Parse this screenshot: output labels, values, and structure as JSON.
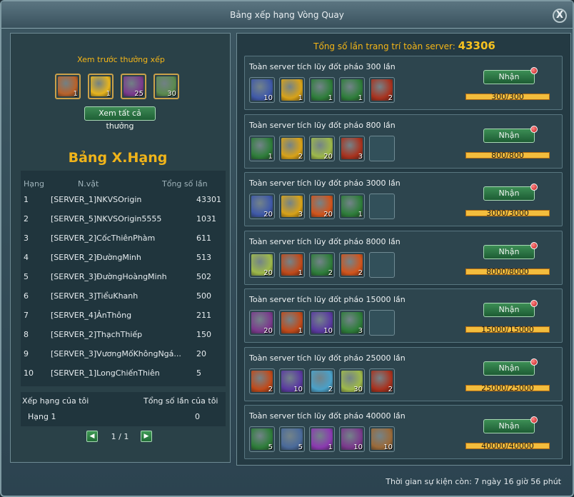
{
  "window": {
    "title": "Bảng xếp hạng Vòng Quay",
    "close_label": "X"
  },
  "preview": {
    "title": "Xem trước thưởng xếp",
    "items": [
      {
        "icon": "scroll-item-icon",
        "qty": "1",
        "color": "#b8622b"
      },
      {
        "icon": "gold-ingot-icon",
        "qty": "1",
        "color": "#e6b41e"
      },
      {
        "icon": "gift-box-icon",
        "qty": "25",
        "color": "#7a3a8c"
      },
      {
        "icon": "scroll-map-icon",
        "qty": "30",
        "color": "#5b8a4f"
      }
    ],
    "view_all_label": "Xem tất cả thưởng"
  },
  "ranking": {
    "title": "Bảng X.Hạng",
    "headers": {
      "rank": "Hạng",
      "name": "N.vật",
      "count": "Tổng số lần"
    },
    "rows": [
      {
        "rank": "1",
        "name": "[SERVER_1]NKVSOrigin",
        "count": "43301"
      },
      {
        "rank": "2",
        "name": "[SERVER_5]NKVSOrigin5555",
        "count": "1031"
      },
      {
        "rank": "3",
        "name": "[SERVER_2]CốcThiênPhàm",
        "count": "611"
      },
      {
        "rank": "4",
        "name": "[SERVER_2]ĐườngMinh",
        "count": "513"
      },
      {
        "rank": "5",
        "name": "[SERVER_3]ĐườngHoàngMinh",
        "count": "502"
      },
      {
        "rank": "6",
        "name": "[SERVER_3]TiểuKhanh",
        "count": "500"
      },
      {
        "rank": "7",
        "name": "[SERVER_4]ẢnThông",
        "count": "211"
      },
      {
        "rank": "8",
        "name": "[SERVER_2]ThạchThiếp",
        "count": "150"
      },
      {
        "rank": "9",
        "name": "[SERVER_3]VươngMốKhôngNgá...",
        "count": "20"
      },
      {
        "rank": "10",
        "name": "[SERVER_1]LongChiếnThiên",
        "count": "5"
      }
    ]
  },
  "my_rank": {
    "rank_label": "Xếp hạng của tôi",
    "count_label": "Tổng số lần của tôi",
    "rank_value": "Hạng 1",
    "count_value": "0"
  },
  "pager": {
    "text": "1 / 1",
    "prev": "◀",
    "next": "▶"
  },
  "total": {
    "label": "Tổng số lần trang trí toàn server:",
    "value": "43306"
  },
  "rewards": [
    {
      "label": "Toàn server tích lũy đốt pháo 300 lần",
      "button": "Nhận",
      "progress_text": "300/300",
      "progress": 1.0,
      "items": [
        {
          "icon": "purple-gem-icon",
          "qty": "10",
          "color": "#3f59a8"
        },
        {
          "icon": "gold-ingot-icon",
          "qty": "1",
          "color": "#d8a218"
        },
        {
          "icon": "green-book-icon",
          "qty": "1",
          "color": "#2e7d3a"
        },
        {
          "icon": "green-book-icon",
          "qty": "1",
          "color": "#2e7d3a"
        },
        {
          "icon": "red-armor-icon",
          "qty": "2",
          "color": "#a8321e"
        }
      ]
    },
    {
      "label": "Toàn server tích lũy đốt pháo 800 lần",
      "button": "Nhận",
      "progress_text": "800/800",
      "progress": 1.0,
      "items": [
        {
          "icon": "green-book-icon",
          "qty": "1",
          "color": "#2e7d3a"
        },
        {
          "icon": "gold-ingot-icon",
          "qty": "2",
          "color": "#d8a218"
        },
        {
          "icon": "mystery-box-icon",
          "qty": "20",
          "color": "#9db84a"
        },
        {
          "icon": "red-armor-icon",
          "qty": "3",
          "color": "#a8321e"
        }
      ]
    },
    {
      "label": "Toàn server tích lũy đốt pháo 3000 lần",
      "button": "Nhận",
      "progress_text": "3000/3000",
      "progress": 1.0,
      "items": [
        {
          "icon": "purple-gem-icon",
          "qty": "20",
          "color": "#3f59a8"
        },
        {
          "icon": "gold-ingot-icon",
          "qty": "3",
          "color": "#d8a218"
        },
        {
          "icon": "fire-burst-icon",
          "qty": "20",
          "color": "#d0541c"
        },
        {
          "icon": "green-book-icon",
          "qty": "1",
          "color": "#2e7d3a"
        }
      ]
    },
    {
      "label": "Toàn server tích lũy đốt pháo 8000 lần",
      "button": "Nhận",
      "progress_text": "8000/8000",
      "progress": 1.0,
      "items": [
        {
          "icon": "mystery-box-icon",
          "qty": "20",
          "color": "#9db84a"
        },
        {
          "icon": "red-gold-helmet-icon",
          "qty": "1",
          "color": "#c04a1a"
        },
        {
          "icon": "green-book-icon",
          "qty": "2",
          "color": "#2e7d3a"
        },
        {
          "icon": "fire-burst-icon",
          "qty": "2",
          "color": "#d0541c"
        }
      ]
    },
    {
      "label": "Toàn server tích lũy đốt pháo 15000 lần",
      "button": "Nhận",
      "progress_text": "15000/15000",
      "progress": 1.0,
      "items": [
        {
          "icon": "gift-box-icon",
          "qty": "20",
          "color": "#7a3a8c"
        },
        {
          "icon": "red-gold-helmet-icon",
          "qty": "1",
          "color": "#c04a1a"
        },
        {
          "icon": "pet-egg-icon",
          "qty": "10",
          "color": "#5a3aa0"
        },
        {
          "icon": "green-book-icon",
          "qty": "3",
          "color": "#2e7d3a"
        }
      ]
    },
    {
      "label": "Toàn server tích lũy đốt pháo 25000 lần",
      "button": "Nhận",
      "progress_text": "25000/25000",
      "progress": 1.0,
      "items": [
        {
          "icon": "red-gold-helmet-icon",
          "qty": "2",
          "color": "#c04a1a"
        },
        {
          "icon": "pet-egg-icon",
          "qty": "10",
          "color": "#5a3aa0"
        },
        {
          "icon": "mystery-box-icon",
          "qty": "2",
          "color": "#4aa0c8"
        },
        {
          "icon": "mystery-box-icon",
          "qty": "30",
          "color": "#9db84a"
        },
        {
          "icon": "red-armor-icon",
          "qty": "2",
          "color": "#a8321e"
        }
      ]
    },
    {
      "label": "Toàn server tích lũy đốt pháo 40000 lần",
      "button": "Nhận",
      "progress_text": "40000/40000",
      "progress": 1.0,
      "items": [
        {
          "icon": "green-book-icon",
          "qty": "5",
          "color": "#2e7d3a"
        },
        {
          "icon": "red-thread-icon",
          "qty": "5",
          "color": "#4a6a9a"
        },
        {
          "icon": "purple-bag-icon",
          "qty": "1",
          "color": "#8a3ab0"
        },
        {
          "icon": "gift-box-icon",
          "qty": "10",
          "color": "#7a3a8c"
        },
        {
          "icon": "gift-box-icon",
          "qty": "10",
          "color": "#9a6a3a"
        }
      ]
    }
  ],
  "footer": {
    "countdown": "Thời gian sự kiện còn: 7 ngày 16 giờ 56 phút"
  }
}
